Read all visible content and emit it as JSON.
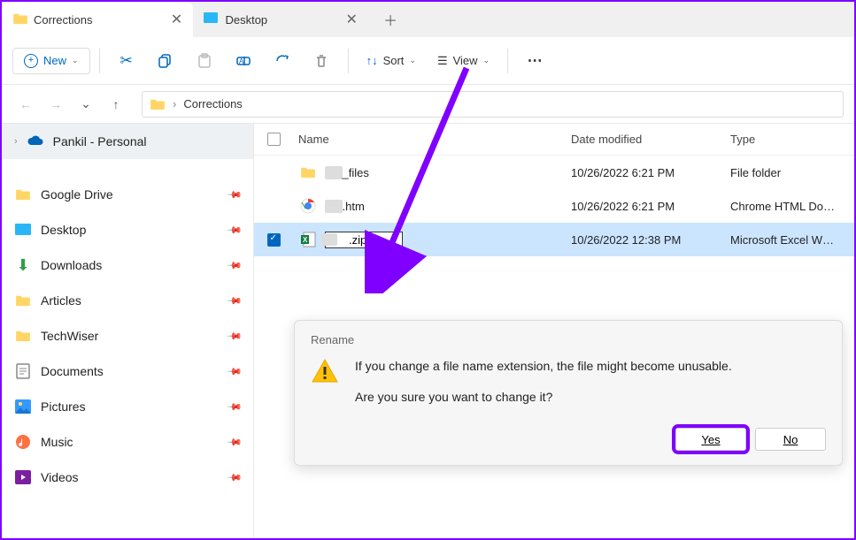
{
  "tabs": [
    {
      "title": "Corrections",
      "active": true
    },
    {
      "title": "Desktop",
      "active": false
    }
  ],
  "toolbar": {
    "new_label": "New",
    "sort_label": "Sort",
    "view_label": "View"
  },
  "breadcrumb": "Corrections",
  "sidebar": {
    "top": "Pankil - Personal",
    "items": [
      {
        "label": "Google Drive",
        "kind": "folder"
      },
      {
        "label": "Desktop",
        "kind": "desktop"
      },
      {
        "label": "Downloads",
        "kind": "downloads"
      },
      {
        "label": "Articles",
        "kind": "folder"
      },
      {
        "label": "TechWiser",
        "kind": "folder"
      },
      {
        "label": "Documents",
        "kind": "documents"
      },
      {
        "label": "Pictures",
        "kind": "pictures"
      },
      {
        "label": "Music",
        "kind": "music"
      },
      {
        "label": "Videos",
        "kind": "videos"
      }
    ]
  },
  "columns": {
    "name": "Name",
    "date": "Date modified",
    "type": "Type"
  },
  "files": [
    {
      "name_redacted": "_files",
      "date": "10/26/2022 6:21 PM",
      "type": "File folder",
      "kind": "folder"
    },
    {
      "name_redacted": ".htm",
      "date": "10/26/2022 6:21 PM",
      "type": "Chrome HTML Do…",
      "kind": "chrome"
    },
    {
      "name_redacted": ".zip",
      "date": "10/26/2022 12:38 PM",
      "type": "Microsoft Excel W…",
      "kind": "excel",
      "selected": true,
      "renaming": true
    }
  ],
  "dialog": {
    "title": "Rename",
    "line1": "If you change a file name extension, the file might become unusable.",
    "line2": "Are you sure you want to change it?",
    "yes": "Yes",
    "no": "No"
  }
}
